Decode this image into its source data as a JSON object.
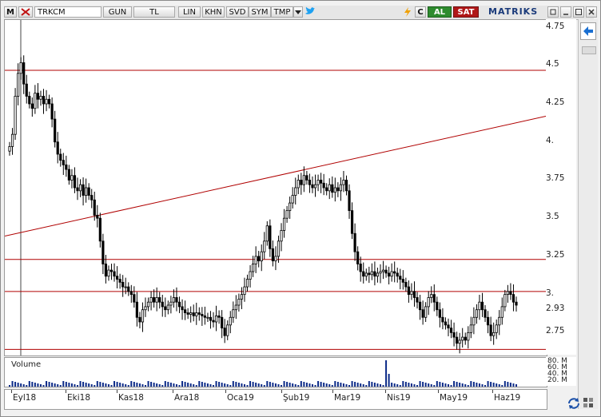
{
  "toolbar": {
    "m_label": "M",
    "symbol": "TRKCM",
    "period": "GUN",
    "currency": "TL",
    "buttons": [
      "LIN",
      "KHN",
      "SVD",
      "SYM",
      "TMP"
    ],
    "refresh_label": "C",
    "buy_label": "AL",
    "sell_label": "SAT",
    "brand": "MATRIKS",
    "buy_color": "#2e8b2e",
    "sell_color": "#b01818"
  },
  "icons": [
    "close-icon",
    "lightning-icon",
    "twitter-icon",
    "restore-icon",
    "minimize-icon",
    "maximize-icon",
    "window-close-icon",
    "back-arrow-icon",
    "refresh-icon",
    "settings-icon"
  ],
  "volume_label": "Volume",
  "volume_ticks": [
    "80. M",
    "60. M",
    "40. M",
    "20. M"
  ],
  "chart_data": {
    "type": "candlestick",
    "symbol": "TRKCM",
    "x_labels": [
      "Eyl18",
      "Eki18",
      "Kas18",
      "Ara18",
      "Oca19",
      "Şub19",
      "Mar19",
      "Nis19",
      "May19",
      "Haz19"
    ],
    "y_ticks": [
      "4.75",
      "4.5",
      "4.25",
      "4.",
      "3.75",
      "3.5",
      "3.25",
      "3.",
      "2.75"
    ],
    "ylim": [
      2.6,
      4.8
    ],
    "last_price": "2.93",
    "horizontal_levels": [
      4.47,
      3.23,
      3.02,
      2.64
    ],
    "trendline": {
      "start": [
        0,
        3.39
      ],
      "end": [
        197,
        4.2
      ]
    },
    "close": [
      3.97,
      4.05,
      4.3,
      4.45,
      4.52,
      4.38,
      4.3,
      4.25,
      4.22,
      4.32,
      4.28,
      4.3,
      4.25,
      4.28,
      4.25,
      4.15,
      4.0,
      3.92,
      3.88,
      3.85,
      3.82,
      3.75,
      3.78,
      3.7,
      3.68,
      3.72,
      3.65,
      3.7,
      3.65,
      3.62,
      3.52,
      3.5,
      3.35,
      3.2,
      3.12,
      3.16,
      3.15,
      3.12,
      3.1,
      3.08,
      3.05,
      3.05,
      3.02,
      3.0,
      2.95,
      2.85,
      2.82,
      2.9,
      2.92,
      2.95,
      2.98,
      2.95,
      2.98,
      2.95,
      2.92,
      2.9,
      2.93,
      2.95,
      2.98,
      2.95,
      2.92,
      2.9,
      2.88,
      2.87,
      2.88,
      2.86,
      2.88,
      2.87,
      2.86,
      2.85,
      2.85,
      2.83,
      2.82,
      2.86,
      2.85,
      2.78,
      2.73,
      2.8,
      2.85,
      2.9,
      2.93,
      2.97,
      3.0,
      3.05,
      3.1,
      3.15,
      3.2,
      3.25,
      3.22,
      3.28,
      3.35,
      3.45,
      3.3,
      3.22,
      3.25,
      3.35,
      3.42,
      3.5,
      3.55,
      3.6,
      3.65,
      3.7,
      3.75,
      3.72,
      3.78,
      3.75,
      3.72,
      3.7,
      3.72,
      3.75,
      3.73,
      3.7,
      3.68,
      3.72,
      3.67,
      3.7,
      3.68,
      3.72,
      3.75,
      3.68,
      3.55,
      3.4,
      3.28,
      3.2,
      3.15,
      3.12,
      3.14,
      3.13,
      3.15,
      3.12,
      3.14,
      3.15,
      3.16,
      3.14,
      3.12,
      3.15,
      3.14,
      3.12,
      3.1,
      3.08,
      3.05,
      3.0,
      3.02,
      2.98,
      2.95,
      2.9,
      2.85,
      2.92,
      2.98,
      3.0,
      2.95,
      2.9,
      2.85,
      2.82,
      2.8,
      2.78,
      2.75,
      2.72,
      2.68,
      2.7,
      2.72,
      2.7,
      2.75,
      2.8,
      2.85,
      2.9,
      2.95,
      2.9,
      2.85,
      2.8,
      2.73,
      2.75,
      2.8,
      2.85,
      2.92,
      3.0,
      3.02,
      3.0,
      2.95,
      2.93
    ]
  }
}
